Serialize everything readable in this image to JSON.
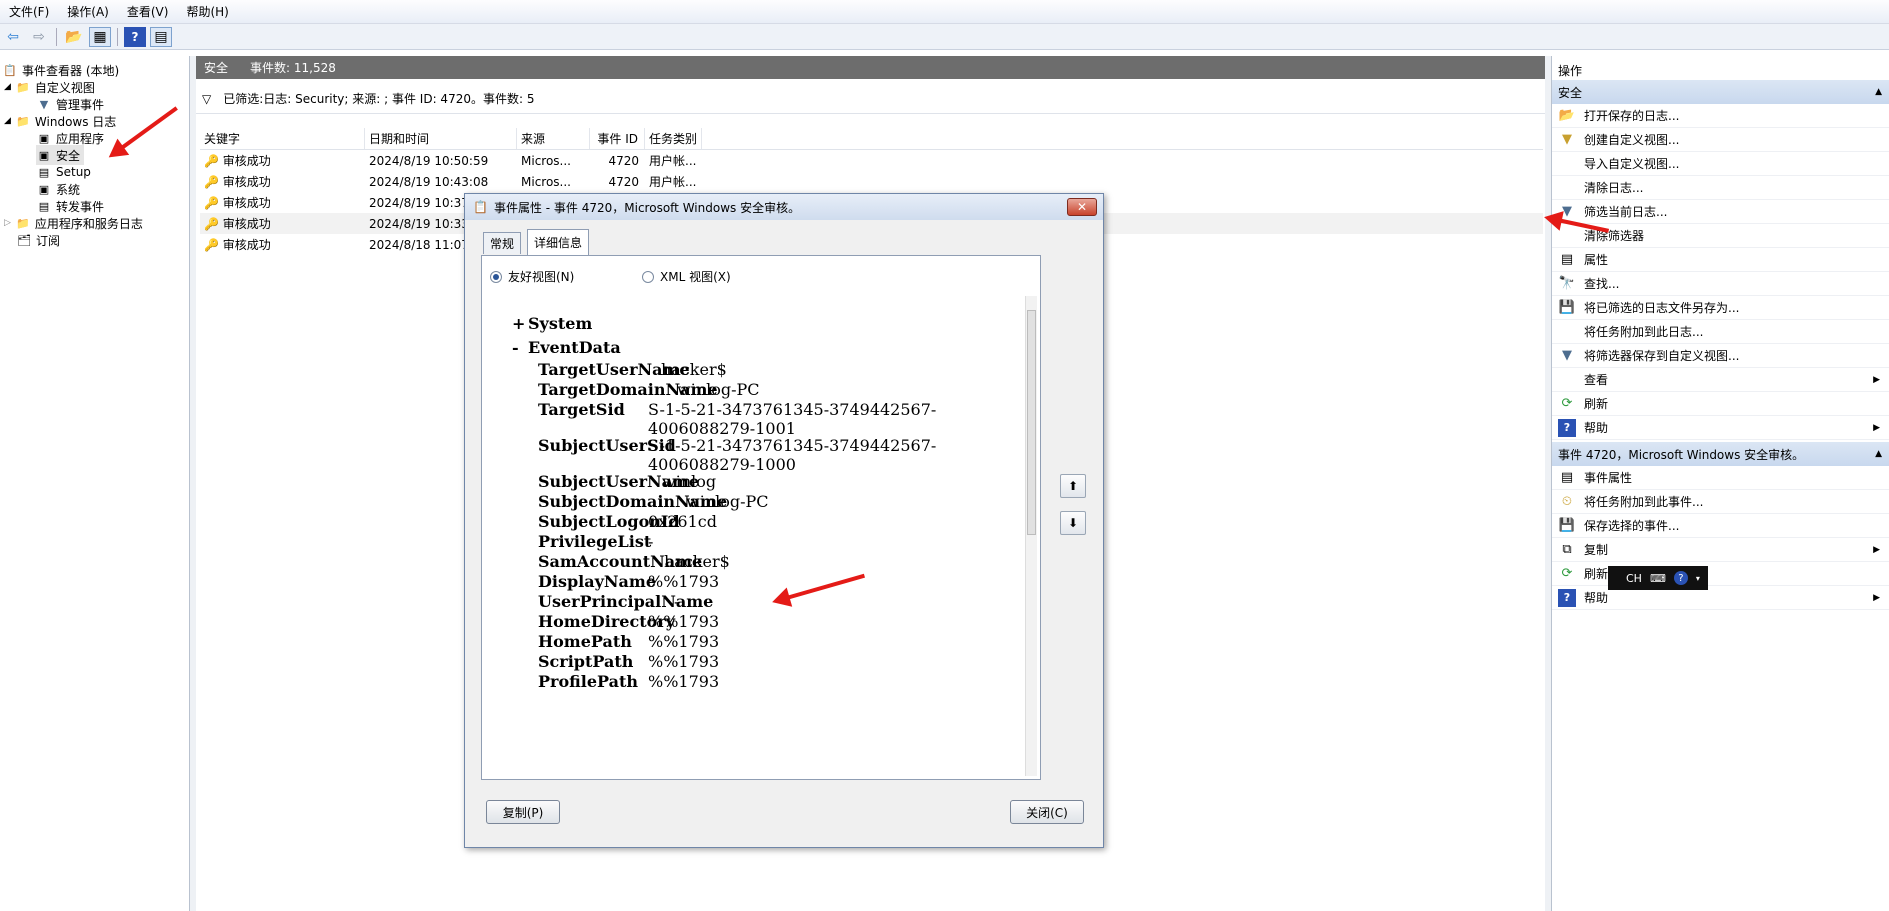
{
  "menu": [
    "文件(F)",
    "操作(A)",
    "查看(V)",
    "帮助(H)"
  ],
  "tree": {
    "root": "事件查看器 (本地)",
    "custom_views": "自定义视图",
    "admin_events": "管理事件",
    "windows_logs": "Windows 日志",
    "application": "应用程序",
    "security": "安全",
    "setup": "Setup",
    "system": "系统",
    "forwarded": "转发事件",
    "app_service_logs": "应用程序和服务日志",
    "subscriptions": "订阅"
  },
  "center": {
    "log_name": "安全",
    "event_count": "事件数: 11,528",
    "filter_text": "已筛选:日志: Security; 来源: ; 事件 ID: 4720。事件数: 5",
    "columns": [
      "关键字",
      "日期和时间",
      "来源",
      "事件 ID",
      "任务类别"
    ],
    "rows": [
      {
        "keyword": "审核成功",
        "datetime": "2024/8/19 10:50:59",
        "source": "Micros...",
        "id": "4720",
        "task": "用户帐..."
      },
      {
        "keyword": "审核成功",
        "datetime": "2024/8/19 10:43:08",
        "source": "Micros...",
        "id": "4720",
        "task": "用户帐..."
      },
      {
        "keyword": "审核成功",
        "datetime": "2024/8/19 10:37",
        "source": "",
        "id": "",
        "task": ""
      },
      {
        "keyword": "审核成功",
        "datetime": "2024/8/19 10:33",
        "source": "",
        "id": "",
        "task": ""
      },
      {
        "keyword": "审核成功",
        "datetime": "2024/8/18 11:07",
        "source": "",
        "id": "",
        "task": ""
      }
    ]
  },
  "actions": {
    "header": "操作",
    "section1": "安全",
    "items1": [
      "打开保存的日志...",
      "创建自定义视图...",
      "导入自定义视图...",
      "清除日志...",
      "筛选当前日志...",
      "清除筛选器",
      "属性",
      "查找...",
      "将已筛选的日志文件另存为...",
      "将任务附加到此日志...",
      "将筛选器保存到自定义视图...",
      "查看",
      "刷新",
      "帮助"
    ],
    "section2": "事件 4720，Microsoft Windows 安全审核。",
    "items2": [
      "事件属性",
      "将任务附加到此事件...",
      "保存选择的事件...",
      "复制",
      "刷新",
      "帮助"
    ]
  },
  "dialog": {
    "title": "事件属性 - 事件 4720，Microsoft Windows 安全审核。",
    "tab_general": "常规",
    "tab_details": "详细信息",
    "radio_friendly": "友好视图(N)",
    "radio_xml": "XML 视图(X)",
    "system_label": "System",
    "eventdata_label": "EventData",
    "fields": [
      {
        "k": "TargetUserName",
        "v": "hacker$"
      },
      {
        "k": "TargetDomainName",
        "v": "winlog-PC"
      },
      {
        "k": "TargetSid",
        "v": "S-1-5-21-3473761345-3749442567-",
        "v2": "4006088279-1001"
      },
      {
        "k": "SubjectUserSid",
        "v": "S-1-5-21-3473761345-3749442567-",
        "v2": "4006088279-1000"
      },
      {
        "k": "SubjectUserName",
        "v": "winlog"
      },
      {
        "k": "SubjectDomainName",
        "v": "winlog-PC"
      },
      {
        "k": "SubjectLogonId",
        "v": "0x261cd"
      },
      {
        "k": "PrivilegeList",
        "v": "-"
      },
      {
        "k": "SamAccountName",
        "v": "hacker$"
      },
      {
        "k": "DisplayName",
        "v": "%%1793"
      },
      {
        "k": "UserPrincipalName",
        "v": "-"
      },
      {
        "k": "HomeDirectory",
        "v": "%%1793"
      },
      {
        "k": "HomePath",
        "v": "%%1793"
      },
      {
        "k": "ScriptPath",
        "v": "%%1793"
      },
      {
        "k": "ProfilePath",
        "v": "%%1793"
      }
    ],
    "copy_button": "复制(P)",
    "close_button": "关闭(C)"
  },
  "ime": {
    "lang": "CH"
  },
  "colors": {
    "arrow": "#e41b17",
    "header_bg": "#6d6d6d",
    "section_bg": "#c8d8ee"
  }
}
